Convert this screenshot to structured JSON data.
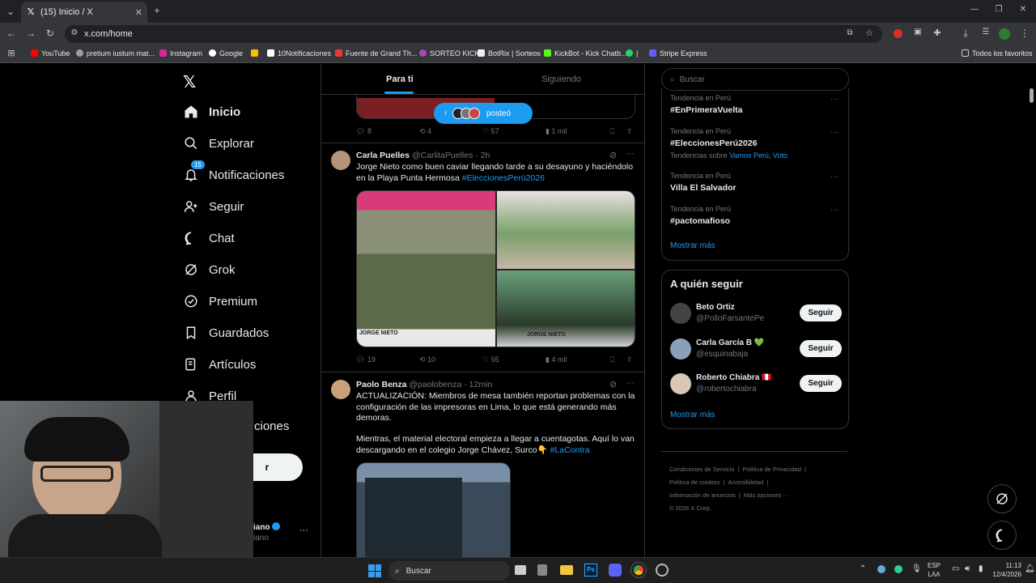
{
  "browser": {
    "tab_title": "(15) Inicio / X",
    "url": "x.com/home",
    "bookmarks": [
      "YouTube",
      "pretium iustum mat...",
      "Instagram",
      "Google",
      "10Notificaciones",
      "Fuente de Grand Th...",
      "SORTEO KICK",
      "BotRix | Sorteos",
      "KickBot - Kick Chatb...",
      "Stripe Express"
    ],
    "all_bookmarks": "Todos los favoritos"
  },
  "nav": {
    "items": [
      "Inicio",
      "Explorar",
      "Notificaciones",
      "Seguir",
      "Chat",
      "Grok",
      "Premium",
      "Guardados",
      "Artículos",
      "Perfil"
    ],
    "notif_badge": "15",
    "partial_more": "ciones",
    "partial_post_btn": "r",
    "account_name_partial": "iano",
    "account_handle_partial": "iano"
  },
  "timeline": {
    "tabs": [
      "Para ti",
      "Siguiendo"
    ],
    "posted_pill": "posteó",
    "post0_actions": {
      "replies": "8",
      "reposts": "4",
      "likes": "57",
      "views": "1 mil"
    },
    "posts": [
      {
        "name": "Carla Puelles",
        "handle": "@CarlitaPuelles",
        "time": "· 2h",
        "text": "Jorge Nieto como buen caviar llegando tarde a su desayuno y haciéndolo en la Playa Punta Hermosa",
        "hashtag": "#EleccionesPerú2026",
        "caption1": "JORGE NIETO",
        "caption2": "JORGE NIETO",
        "replies": "19",
        "reposts": "10",
        "likes": "55",
        "views": "4 mil"
      },
      {
        "name": "Paolo Benza",
        "handle": "@paolobenza",
        "time": "· 12min",
        "text1": "ACTUALIZACIÓN: Miembros de mesa también reportan problemas con la configuración de las impresoras en Lima, lo que está generando más demoras.",
        "text2": "Mientras, el material electoral empieza a llegar a cuentagotas. Aquí lo van descargando en el colegio Jorge Chávez, Surco👇",
        "hashtag": "#LaContra"
      }
    ]
  },
  "sidebar": {
    "search_placeholder": "Buscar",
    "trends": [
      {
        "context": "Tendencia en Perú",
        "name": "#EnPrimeraVuelta"
      },
      {
        "context": "Tendencia en Perú",
        "name": "#EleccionesPerú2026",
        "extra_prefix": "Tendencias sobre",
        "extra_links": "Vamos Perú, Voto"
      },
      {
        "context": "Tendencia en Perú",
        "name": "Villa El Salvador"
      },
      {
        "context": "Tendencia en Perú",
        "name": "#pactomafioso"
      }
    ],
    "show_more": "Mostrar más",
    "who_to_follow": "A quién seguir",
    "follow": [
      {
        "name": "Beto Ortiz",
        "handle": "@PolloFarsantePe",
        "btn": "Seguir"
      },
      {
        "name": "Carla García B 💚",
        "handle": "@esquinabaja",
        "btn": "Seguir"
      },
      {
        "name": "Roberto Chiabra 🇵🇪",
        "handle": "@robertochiabra",
        "btn": "Seguir"
      }
    ],
    "show_more2": "Mostrar más",
    "footer": [
      "Condiciones de Servicio",
      "Política de Privacidad",
      "Política de cookies",
      "Accesibilidad",
      "Información de anuncios",
      "Más opciones ···",
      "© 2026 X Corp."
    ]
  },
  "taskbar": {
    "search": "Buscar",
    "lang1": "ESP",
    "lang2": "LAA",
    "time": "11:13",
    "date": "12/4/2026"
  },
  "colors": {
    "accent": "#1d9bf0",
    "bg": "#000000",
    "border": "#2f3336",
    "muted": "#71767b"
  }
}
